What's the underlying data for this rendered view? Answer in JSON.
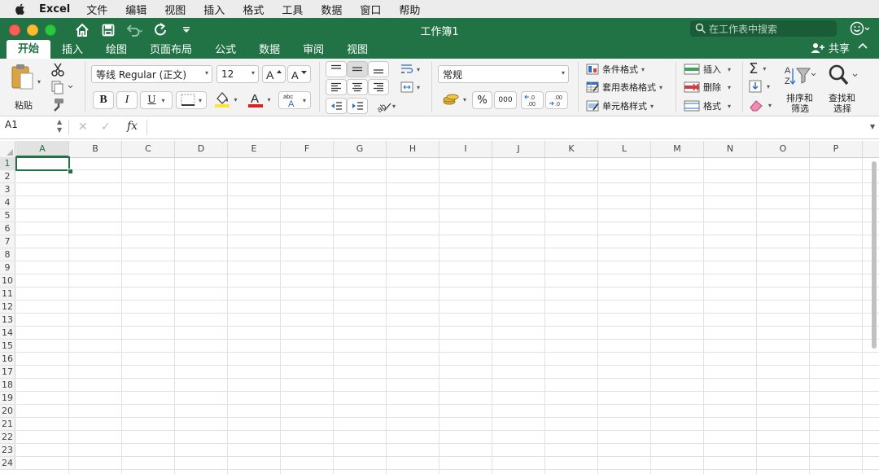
{
  "menubar": {
    "app_name": "Excel",
    "items": [
      "文件",
      "编辑",
      "视图",
      "插入",
      "格式",
      "工具",
      "数据",
      "窗口",
      "帮助"
    ]
  },
  "window": {
    "title": "工作簿1"
  },
  "search": {
    "placeholder": "在工作表中搜索"
  },
  "ribbon_tabs": [
    "开始",
    "插入",
    "绘图",
    "页面布局",
    "公式",
    "数据",
    "审阅",
    "视图"
  ],
  "share_label": "共享",
  "clipboard": {
    "paste_label": "粘贴"
  },
  "font": {
    "name": "等线 Regular (正文)",
    "size": "12",
    "bold": "B",
    "italic": "I",
    "underline": "U"
  },
  "number": {
    "format": "常规",
    "percent": "%",
    "comma": "000"
  },
  "styles": {
    "conditional": "条件格式",
    "table": "套用表格格式",
    "cell": "单元格样式"
  },
  "cells_group": {
    "insert": "插入",
    "delete": "删除",
    "format": "格式"
  },
  "editing": {
    "sort_filter": [
      "排序和",
      "筛选"
    ],
    "find_select": [
      "查找和",
      "选择"
    ]
  },
  "formula_bar": {
    "name_box": "A1",
    "fx": "fx"
  },
  "grid": {
    "columns": [
      "A",
      "B",
      "C",
      "D",
      "E",
      "F",
      "G",
      "H",
      "I",
      "J",
      "K",
      "L",
      "M",
      "N",
      "O",
      "P"
    ],
    "rows": [
      "1",
      "2",
      "3",
      "4",
      "5",
      "6",
      "7",
      "8",
      "9",
      "10",
      "11",
      "12",
      "13",
      "14",
      "15",
      "16",
      "17",
      "18",
      "19",
      "20",
      "21",
      "22",
      "23",
      "24"
    ],
    "active_cell": "A1"
  },
  "colors": {
    "accent": "#217346",
    "font_color": "#e02020",
    "highlight": "#f7e53b"
  }
}
